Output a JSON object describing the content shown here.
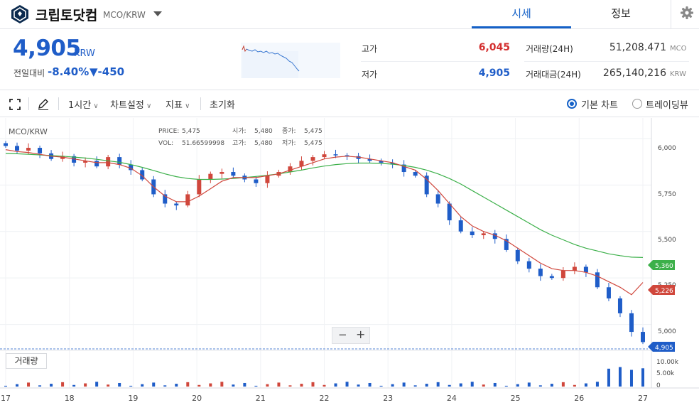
{
  "header": {
    "coin_name": "크립토닷컴",
    "pair": "MCO/KRW",
    "tabs": [
      "시세",
      "정보"
    ]
  },
  "price": {
    "current": "4,905",
    "unit": "KRW",
    "change_label": "전일대비",
    "change_pct": "-8.40%",
    "change_amt": "▼-450",
    "color_down": "#1f5dc8",
    "color_up": "#d32f2f"
  },
  "stats": {
    "high_label": "고가",
    "high_value": "6,045",
    "low_label": "저가",
    "low_value": "4,905",
    "volume_label": "거래량(24H)",
    "volume_value": "51,208.471",
    "volume_unit": "MCO",
    "amount_label": "거래대금(24H)",
    "amount_value": "265,140,216",
    "amount_unit": "KRW"
  },
  "toolbar": {
    "interval": "1시간",
    "chart_settings": "차트설정",
    "indicators": "지표",
    "reset": "초기화",
    "basic_chart": "기본 차트",
    "tradingview": "트레이딩뷰"
  },
  "chart_legend": {
    "symbol": "MCO/KRW",
    "price_label": "PRICE:",
    "price_value": "5,475",
    "vol_label": "VOL:",
    "vol_value": "51.66599998",
    "open_label": "시가:",
    "open_value": "5,480",
    "high_label": "고가:",
    "high_value": "5,480",
    "close_label": "종가:",
    "close_value": "5,475",
    "low_label": "저가:",
    "low_value": "5,475"
  },
  "price_axis": [
    "6,000",
    "5,750",
    "5,500",
    "5,250",
    "5,000"
  ],
  "price_tags": {
    "ma_long": "5,360",
    "ma_short": "5,226",
    "last": "4,905"
  },
  "volume_axis": [
    "10.00k",
    "5.00k",
    "0"
  ],
  "volume_label": "거래량",
  "zoom": {
    "minus": "−",
    "plus": "+"
  },
  "chart_data": {
    "type": "candlestick",
    "interval": "1시간",
    "x_tick_labels": [
      "17",
      "18",
      "19",
      "20",
      "21",
      "22",
      "23",
      "24",
      "25",
      "26",
      "27"
    ],
    "y_ticks": [
      6000,
      5750,
      5500,
      5250,
      5000
    ],
    "ylim": [
      4880,
      6080
    ],
    "volume_ylim": [
      0,
      11000
    ],
    "series": [
      {
        "name": "close",
        "values": [
          5960,
          5935,
          5950,
          5920,
          5890,
          5905,
          5870,
          5880,
          5850,
          5900,
          5860,
          5830,
          5780,
          5700,
          5650,
          5640,
          5700,
          5780,
          5810,
          5820,
          5800,
          5780,
          5760,
          5800,
          5820,
          5850,
          5880,
          5900,
          5915,
          5910,
          5905,
          5890,
          5880,
          5870,
          5860,
          5820,
          5800,
          5700,
          5650,
          5560,
          5500,
          5480,
          5490,
          5460,
          5400,
          5340,
          5300,
          5260,
          5250,
          5290,
          5310,
          5280,
          5200,
          5140,
          5060,
          4960,
          4905
        ]
      },
      {
        "name": "MA short",
        "values": [
          5940,
          5930,
          5925,
          5915,
          5905,
          5900,
          5890,
          5880,
          5870,
          5870,
          5860,
          5840,
          5800,
          5740,
          5690,
          5660,
          5660,
          5690,
          5730,
          5770,
          5790,
          5790,
          5790,
          5800,
          5810,
          5830,
          5850,
          5870,
          5890,
          5900,
          5905,
          5900,
          5890,
          5880,
          5870,
          5850,
          5830,
          5780,
          5720,
          5650,
          5580,
          5530,
          5500,
          5480,
          5450,
          5410,
          5370,
          5330,
          5300,
          5290,
          5290,
          5280,
          5260,
          5230,
          5200,
          5160,
          5226
        ]
      },
      {
        "name": "MA long",
        "values": [
          5920,
          5918,
          5915,
          5912,
          5908,
          5905,
          5900,
          5895,
          5888,
          5880,
          5872,
          5860,
          5845,
          5828,
          5810,
          5795,
          5785,
          5780,
          5780,
          5782,
          5785,
          5790,
          5796,
          5802,
          5810,
          5820,
          5830,
          5842,
          5852,
          5860,
          5865,
          5868,
          5868,
          5866,
          5862,
          5855,
          5845,
          5830,
          5810,
          5785,
          5755,
          5720,
          5685,
          5650,
          5615,
          5580,
          5545,
          5510,
          5480,
          5455,
          5430,
          5410,
          5395,
          5380,
          5370,
          5362,
          5360
        ]
      }
    ]
  }
}
